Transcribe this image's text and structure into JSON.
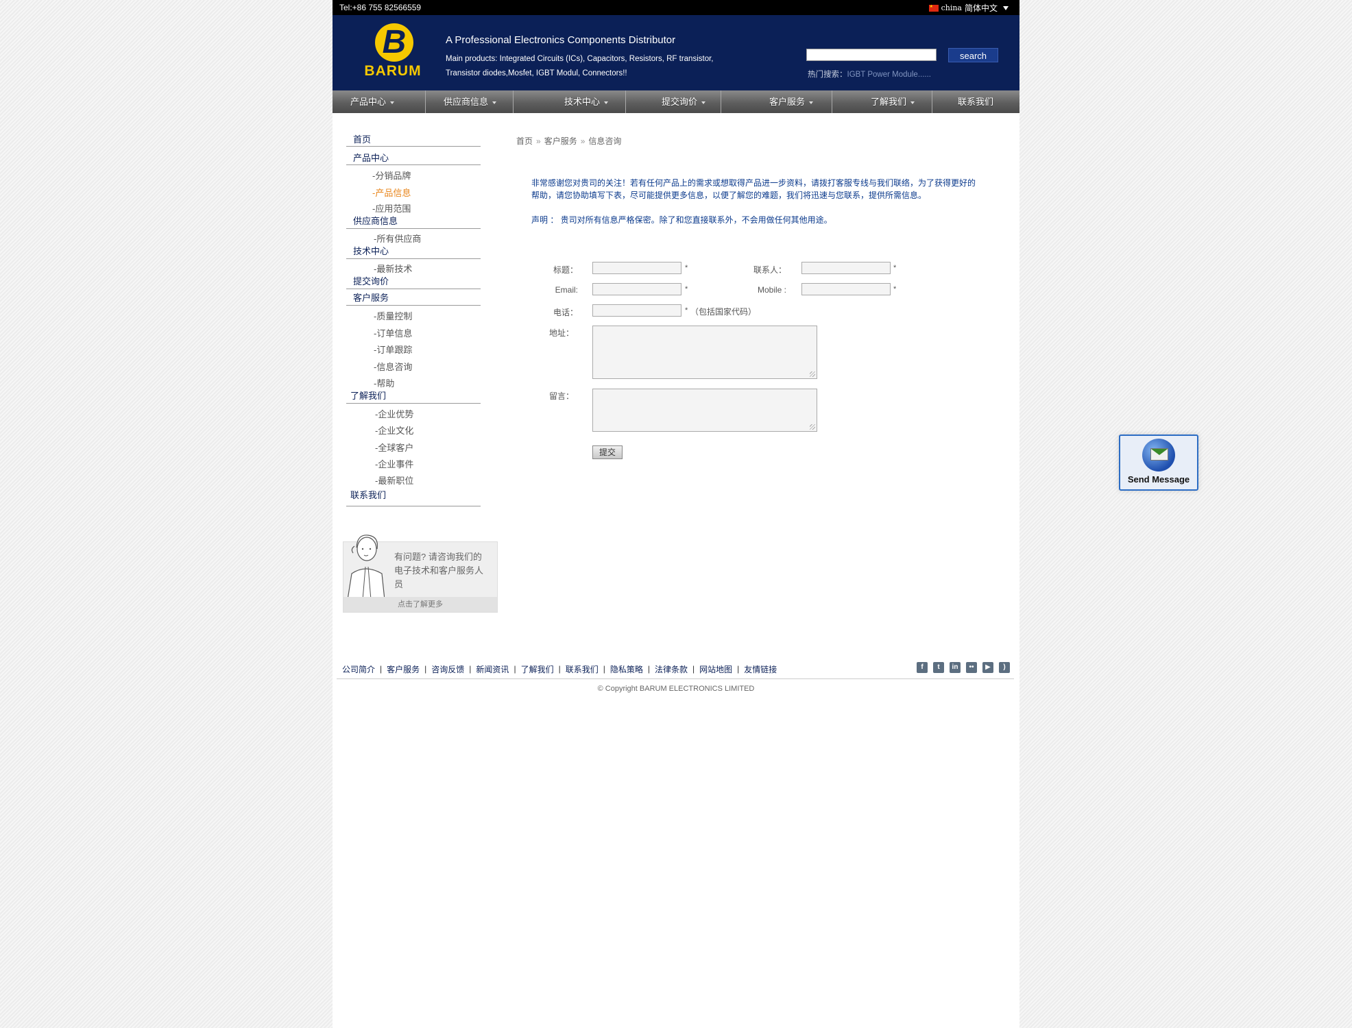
{
  "topbar": {
    "tel": "Tel:+86 755 82566559",
    "lang_region": "china",
    "lang_label": "简体中文"
  },
  "header": {
    "logo_text": "BARUM",
    "tagline": "A Professional Electronics Components Distributor",
    "products": "Main products: Integrated Circuits (ICs), Capacitors, Resistors, RF transistor, Transistor diodes,Mosfet, IGBT Modul, Connectors!!",
    "search_value": "",
    "search_button": "search",
    "hot_label": "热门搜索：",
    "hot_link": "IGBT Power Module......"
  },
  "nav": [
    {
      "label": "产品中心",
      "has_menu": true
    },
    {
      "label": "供应商信息",
      "has_menu": true
    },
    {
      "label": "技术中心",
      "has_menu": true
    },
    {
      "label": "提交询价",
      "has_menu": true
    },
    {
      "label": "客户服务",
      "has_menu": true
    },
    {
      "label": "了解我们",
      "has_menu": true
    },
    {
      "label": "联系我们",
      "has_menu": false
    }
  ],
  "sidebar": {
    "home": "首页",
    "products": "产品中心",
    "products_sub": [
      "-分销品牌",
      "-产品信息",
      "-应用范围"
    ],
    "suppliers": "供应商信息",
    "suppliers_sub": [
      "-所有供应商"
    ],
    "tech": "技术中心",
    "tech_sub": [
      "-最新技术"
    ],
    "inquiry": "提交询价",
    "service": "客户服务",
    "service_sub": [
      "-质量控制",
      "-订单信息",
      "-订单跟踪",
      "-信息咨询",
      "-帮助"
    ],
    "about": "了解我们",
    "about_sub": [
      "-企业优势",
      "-企业文化",
      "-全球客户",
      "-企业事件",
      "-最新职位"
    ],
    "contact": "联系我们"
  },
  "helpbox": {
    "text": "有问题? 请咨询我们的电子技术和客户服务人员",
    "link": "点击了解更多"
  },
  "breadcrumb": [
    "首页",
    "客户服务",
    "信息咨询"
  ],
  "breadcrumb_sep": "»",
  "intro": "非常感谢您对贵司的关注！若有任何产品上的需求或想取得产品进一步资料，请拨打客服专线与我们联络，为了获得更好的帮助，请您协助填写下表，尽可能提供更多信息，以便了解您的难题，我们将迅速与您联系，提供所需信息。",
  "notice": "声明 ： 贵司对所有信息严格保密。除了和您直接联系外，不会用做任何其他用途。",
  "form": {
    "title_label": "标题：",
    "contact_label": "联系人：",
    "email_label": "Email:",
    "mobile_label": "Mobile :",
    "phone_label": "电话：",
    "phone_hint": "（包括国家代码）",
    "address_label": "地址：",
    "message_label": "留言：",
    "required_mark": "*",
    "submit": "提交"
  },
  "footer": {
    "links": [
      "公司简介",
      "客户服务",
      "咨询反馈",
      "新闻资讯",
      "了解我们",
      "联系我们",
      "隐私策略",
      "法律条款",
      "网站地图",
      "友情链接"
    ],
    "link_sep": "|",
    "social": [
      "facebook-icon",
      "twitter-icon",
      "linkedin-icon",
      "flickr-icon",
      "youtube-icon",
      "rss-icon"
    ],
    "copyright": "© Copyright BARUM ELECTRONICS LIMITED"
  },
  "widget": {
    "send_message": "Send Message"
  },
  "colors": {
    "header_bg": "#0b2057",
    "logo": "#f5c800",
    "active": "#e8851b",
    "text_link": "#0b3a8c"
  }
}
